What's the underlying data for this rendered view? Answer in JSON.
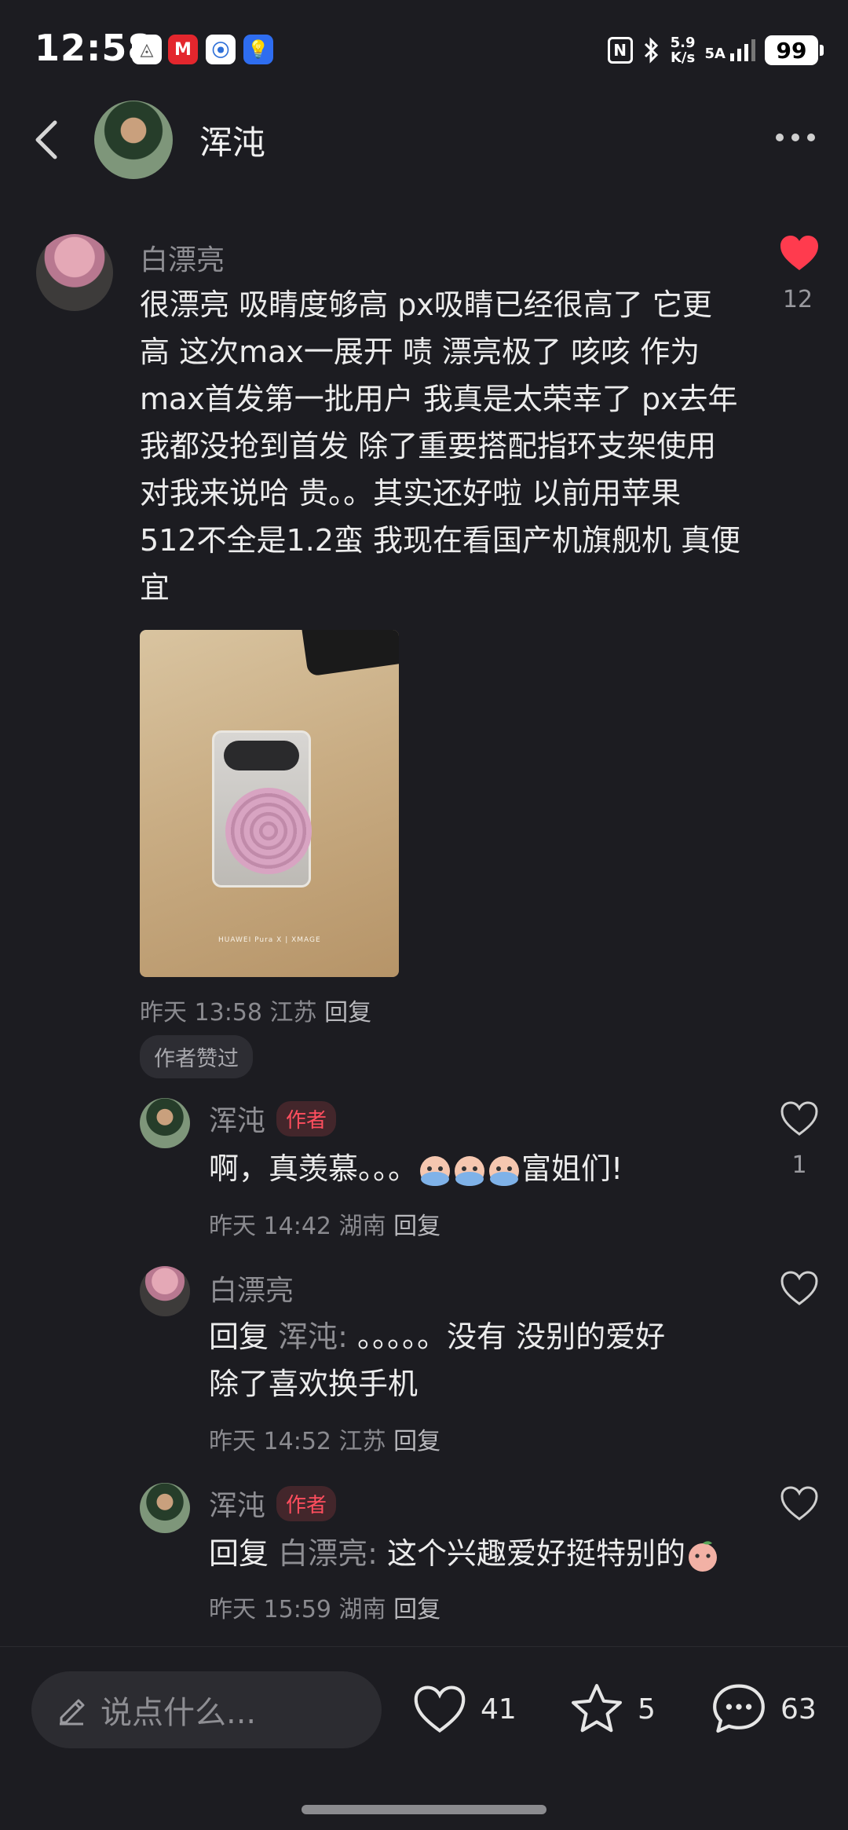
{
  "status_bar": {
    "time": "12:58",
    "network_speed_top": "5.9",
    "network_speed_bottom": "K/s",
    "signal_label": "5A",
    "battery": "99"
  },
  "header": {
    "title": "浑沌"
  },
  "comment": {
    "author": "白漂亮",
    "lines": [
      "很漂亮 吸睛度够高 px吸睛已经很高了 它更",
      "高  这次max一展开 啧 漂亮极了 咳咳 作为",
      "max首发第一批用户 我真是太荣幸了 px去年",
      "我都没抢到首发 除了重要搭配指环支架使用",
      "对我来说哈 贵。。其实还好啦 以前用苹果",
      "512不全是1.2蛮 我现在看国产机旗舰机 真便",
      "宜"
    ],
    "like_count": "12",
    "photo_watermark": "HUAWEI Pura X | XMAGE",
    "time": "昨天 13:58",
    "location": "江苏",
    "reply_label": "回复",
    "chip": "作者赞过"
  },
  "replies": [
    {
      "author": "浑沌",
      "badge": "作者",
      "prefix": "啊，真羡慕。。。",
      "suffix": "富姐们!",
      "like_count": "1",
      "time": "昨天 14:42",
      "location": "湖南",
      "reply_label": "回复"
    },
    {
      "author": "白漂亮",
      "reply_word": "回复",
      "quoted": "浑沌:",
      "line1_rest": "。。。。。没有 没别的爱好",
      "line2": "除了喜欢换手机",
      "time": "昨天 14:52",
      "location": "江苏",
      "reply_label": "回复"
    },
    {
      "author": "浑沌",
      "badge": "作者",
      "reply_word": "回复",
      "quoted": "白漂亮:",
      "text": "这个兴趣爱好挺特别的",
      "time": "昨天 15:59",
      "location": "湖南",
      "reply_label": "回复"
    }
  ],
  "bottom_bar": {
    "input_placeholder": "说点什么...",
    "likes": "41",
    "favorites": "5",
    "comments": "63"
  },
  "colors": {
    "background": "#1c1c21",
    "like_red": "#ff3b4e",
    "author_badge_text": "#ff4e5e"
  },
  "icons": [
    "back-arrow-icon",
    "more-icon",
    "heart-filled-icon",
    "heart-outline-icon",
    "pen-icon",
    "star-icon",
    "chat-bubble-icon"
  ]
}
